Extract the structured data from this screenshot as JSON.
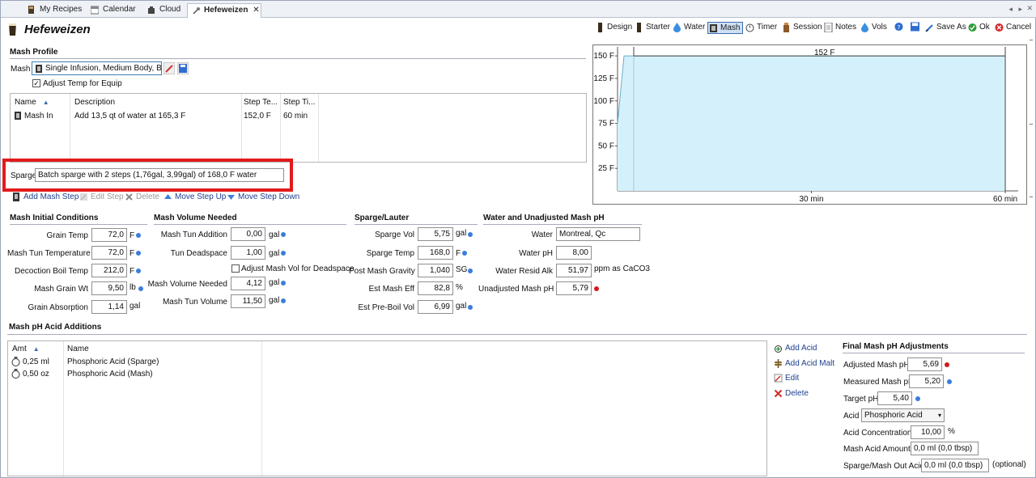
{
  "tabs": [
    {
      "label": "My Recipes"
    },
    {
      "label": "Calendar"
    },
    {
      "label": "Cloud"
    },
    {
      "label": "Hefeweizen",
      "close": "✕"
    }
  ],
  "title": "Hefeweizen",
  "toolbar": {
    "design": "Design",
    "starter": "Starter",
    "water": "Water",
    "mash": "Mash",
    "timer": "Timer",
    "session": "Session",
    "notes": "Notes",
    "vols": "Vols",
    "save_as": "Save As",
    "ok": "Ok",
    "cancel": "Cancel"
  },
  "mash_profile": {
    "header": "Mash Profile",
    "mash_label": "Mash",
    "mash_value": "Single Infusion, Medium Body, Batc",
    "adjust_temp_label": "Adjust Temp for Equip",
    "adjust_temp_checked": true,
    "columns": [
      "Name",
      "Description",
      "Step Te...",
      "Step Ti..."
    ],
    "steps": [
      {
        "name": "Mash In",
        "description": "Add 13,5 qt of water at 165,3 F",
        "temp": "152,0 F",
        "time": "60 min"
      }
    ],
    "sparge_label": "Sparge",
    "sparge_value": "Batch sparge with 2 steps (1,76gal, 3,99gal) of 168,0 F water"
  },
  "step_actions": {
    "add": "Add Mash Step",
    "edit": "Edit Step",
    "delete": "Delete",
    "up": "Move Step Up",
    "down": "Move Step Down"
  },
  "chart_data": {
    "type": "line",
    "y_ticks": [
      "150 F",
      "125 F",
      "100 F",
      "75 F",
      "50 F",
      "25 F"
    ],
    "x_ticks": [
      "30 min",
      "60 min"
    ],
    "ylim": [
      0,
      160
    ],
    "xlim": [
      0,
      62
    ],
    "points": [
      [
        0,
        75
      ],
      [
        1,
        150
      ],
      [
        60,
        150
      ]
    ],
    "annotation": "152 F"
  },
  "mash_initial": {
    "header": "Mash Initial Conditions",
    "grain_temp_label": "Grain Temp",
    "grain_temp": "72,0",
    "grain_temp_unit": "F",
    "tun_temp_label": "Mash Tun Temperature",
    "tun_temp": "72,0",
    "tun_temp_unit": "F",
    "decoction_label": "Decoction Boil Temp",
    "decoction": "212,0",
    "decoction_unit": "F",
    "grain_wt_label": "Mash Grain Wt",
    "grain_wt": "9,50",
    "grain_wt_unit": "lb",
    "absorption_label": "Grain Absorption",
    "absorption": "1,14",
    "absorption_unit": "gal"
  },
  "mash_volume": {
    "header": "Mash Volume Needed",
    "tun_addition_label": "Mash Tun Addition",
    "tun_addition": "0,00",
    "tun_addition_unit": "gal",
    "deadspace_label": "Tun Deadspace",
    "deadspace": "1,00",
    "deadspace_unit": "gal",
    "adjust_deadspace_label": "Adjust Mash Vol for Deadspace",
    "needed_label": "Mash Volume Needed",
    "needed": "4,12",
    "needed_unit": "gal",
    "tun_volume_label": "Mash Tun Volume",
    "tun_volume": "11,50",
    "tun_volume_unit": "gal"
  },
  "sparge_lauter": {
    "header": "Sparge/Lauter",
    "vol_label": "Sparge Vol",
    "vol": "5,75",
    "vol_unit": "gal",
    "temp_label": "Sparge Temp",
    "temp": "168,0",
    "temp_unit": "F",
    "gravity_label": "Post Mash Gravity",
    "gravity": "1,040",
    "gravity_unit": "SG",
    "eff_label": "Est Mash Eff",
    "eff": "82,8",
    "eff_unit": "%",
    "preboil_label": "Est Pre-Boil Vol",
    "preboil": "6,99",
    "preboil_unit": "gal"
  },
  "water_ph": {
    "header": "Water and Unadjusted Mash pH",
    "water_label": "Water",
    "water": "Montreal, Qc",
    "ph_label": "Water pH",
    "ph": "8,00",
    "alk_label": "Water Resid Alk",
    "alk": "51,97",
    "alk_unit": "ppm as CaCO3",
    "unadj_label": "Unadjusted Mash pH",
    "unadj": "5,79"
  },
  "acid_additions": {
    "header": "Mash pH Acid Additions",
    "columns": [
      "Amt",
      "Name"
    ],
    "rows": [
      {
        "amt": "0,25 ml",
        "name": "Phosphoric Acid (Sparge)"
      },
      {
        "amt": "0,50 oz",
        "name": "Phosphoric Acid (Mash)"
      }
    ],
    "add_acid": "Add Acid",
    "add_acid_malt": "Add Acid Malt",
    "edit": "Edit",
    "delete": "Delete"
  },
  "final_ph": {
    "header": "Final Mash pH Adjustments",
    "adjusted_label": "Adjusted Mash pH",
    "adjusted": "5,69",
    "measured_label": "Measured Mash pH",
    "measured": "5,20",
    "target_label": "Target pH",
    "target": "5,40",
    "acid_label": "Acid",
    "acid": "Phosphoric Acid",
    "conc_label": "Acid Concentration",
    "conc": "10,00",
    "conc_unit": "%",
    "mash_amt_label": "Mash Acid Amount",
    "mash_amt": "0,0 ml (0,0 tbsp)",
    "sparge_amt_label": "Sparge/Mash Out Acid",
    "sparge_amt": "0,0 ml (0,0 tbsp)",
    "optional": "(optional)"
  },
  "colors": {
    "accent": "#3b7ddd",
    "warn": "#d11a1a",
    "chart_fill": "#d4f1fb",
    "highlight": "#e21b1b"
  }
}
